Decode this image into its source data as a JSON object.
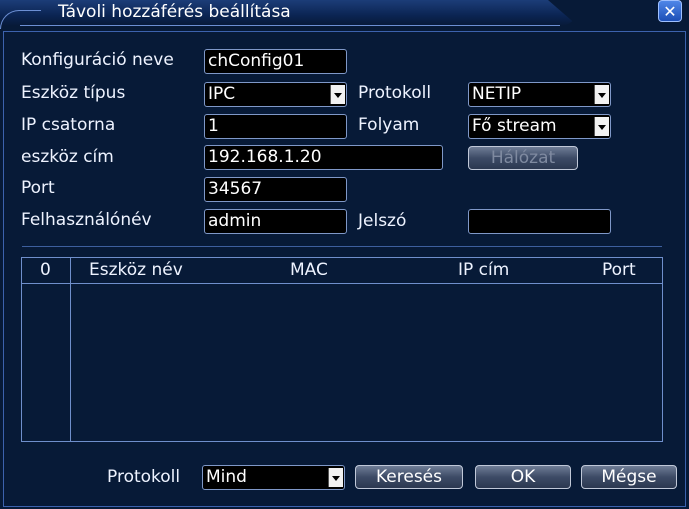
{
  "dialog": {
    "title": "Távoli hozzáférés beállítása",
    "close_glyph": "✕"
  },
  "form": {
    "config_name_label": "Konfiguráció neve",
    "config_name_value": "chConfig01",
    "device_type_label": "Eszköz típus",
    "device_type_value": "IPC",
    "protocol_label": "Protokoll",
    "protocol_value": "NETIP",
    "ip_channel_label": "IP csatorna",
    "ip_channel_value": "1",
    "stream_label": "Folyam",
    "stream_value": "Fő stream",
    "device_address_label": "eszköz cím",
    "device_address_value": "192.168.1.20",
    "network_button": "Hálózat",
    "port_label": "Port",
    "port_value": "34567",
    "username_label": "Felhasználónév",
    "username_value": "admin",
    "password_label": "Jelszó",
    "password_value": ""
  },
  "table": {
    "columns": [
      "0",
      "Eszköz név",
      "MAC",
      "IP cím",
      "Port"
    ],
    "rows": []
  },
  "footer": {
    "protocol_label": "Protokoll",
    "protocol_value": "Mind",
    "search_button": "Keresés",
    "ok_button": "OK",
    "cancel_button": "Mégse"
  },
  "colors": {
    "background": "#071a37",
    "frame": "#3c62ad",
    "close_button": "#2f63cf"
  }
}
